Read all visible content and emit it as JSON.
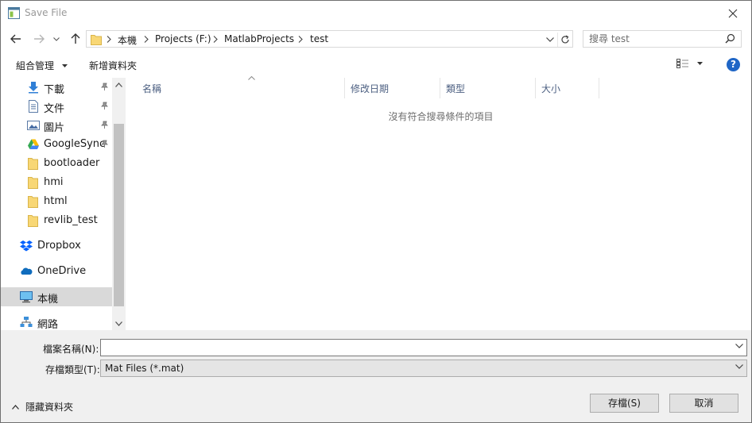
{
  "window": {
    "title": "Save File",
    "close_label": "✕"
  },
  "breadcrumbs": [
    "本機",
    "Projects (F:)",
    "MatlabProjects",
    "test"
  ],
  "search": {
    "placeholder": "搜尋 test"
  },
  "toolbar": {
    "organize_label": "組合管理",
    "new_folder_label": "新增資料夾",
    "help_label": "?"
  },
  "sidebar": {
    "items": [
      {
        "label": "下載",
        "icon": "download-icon",
        "pinned": true
      },
      {
        "label": "文件",
        "icon": "document-icon",
        "pinned": true
      },
      {
        "label": "圖片",
        "icon": "pictures-icon",
        "pinned": true
      },
      {
        "label": "GoogleSync",
        "icon": "google-drive-icon",
        "pinned": true
      },
      {
        "label": "bootloader",
        "icon": "folder-icon",
        "pinned": false
      },
      {
        "label": "hmi",
        "icon": "folder-icon",
        "pinned": false
      },
      {
        "label": "html",
        "icon": "folder-icon",
        "pinned": false
      },
      {
        "label": "revlib_test",
        "icon": "folder-icon",
        "pinned": false
      }
    ],
    "roots": [
      {
        "label": "Dropbox",
        "icon": "dropbox-icon"
      },
      {
        "label": "OneDrive",
        "icon": "onedrive-icon"
      },
      {
        "label": "本機",
        "icon": "this-pc-icon",
        "selected": true
      },
      {
        "label": "網路",
        "icon": "network-icon"
      }
    ]
  },
  "filelist": {
    "columns": [
      "名稱",
      "修改日期",
      "類型",
      "大小"
    ],
    "empty_message": "沒有符合搜尋條件的項目"
  },
  "form": {
    "filename_label": "檔案名稱(N):",
    "filename_value": "",
    "filetype_label": "存檔類型(T):",
    "filetype_value": "Mat Files (*.mat)"
  },
  "footer": {
    "hide_folders_label": "隱藏資料夾",
    "save_label": "存檔(S)",
    "cancel_label": "取消"
  },
  "colors": {
    "accent": "#1f66c6",
    "selected_bg": "#d9d9d9",
    "panel_bg": "#f0f0f0",
    "header_text": "#4d6082"
  }
}
